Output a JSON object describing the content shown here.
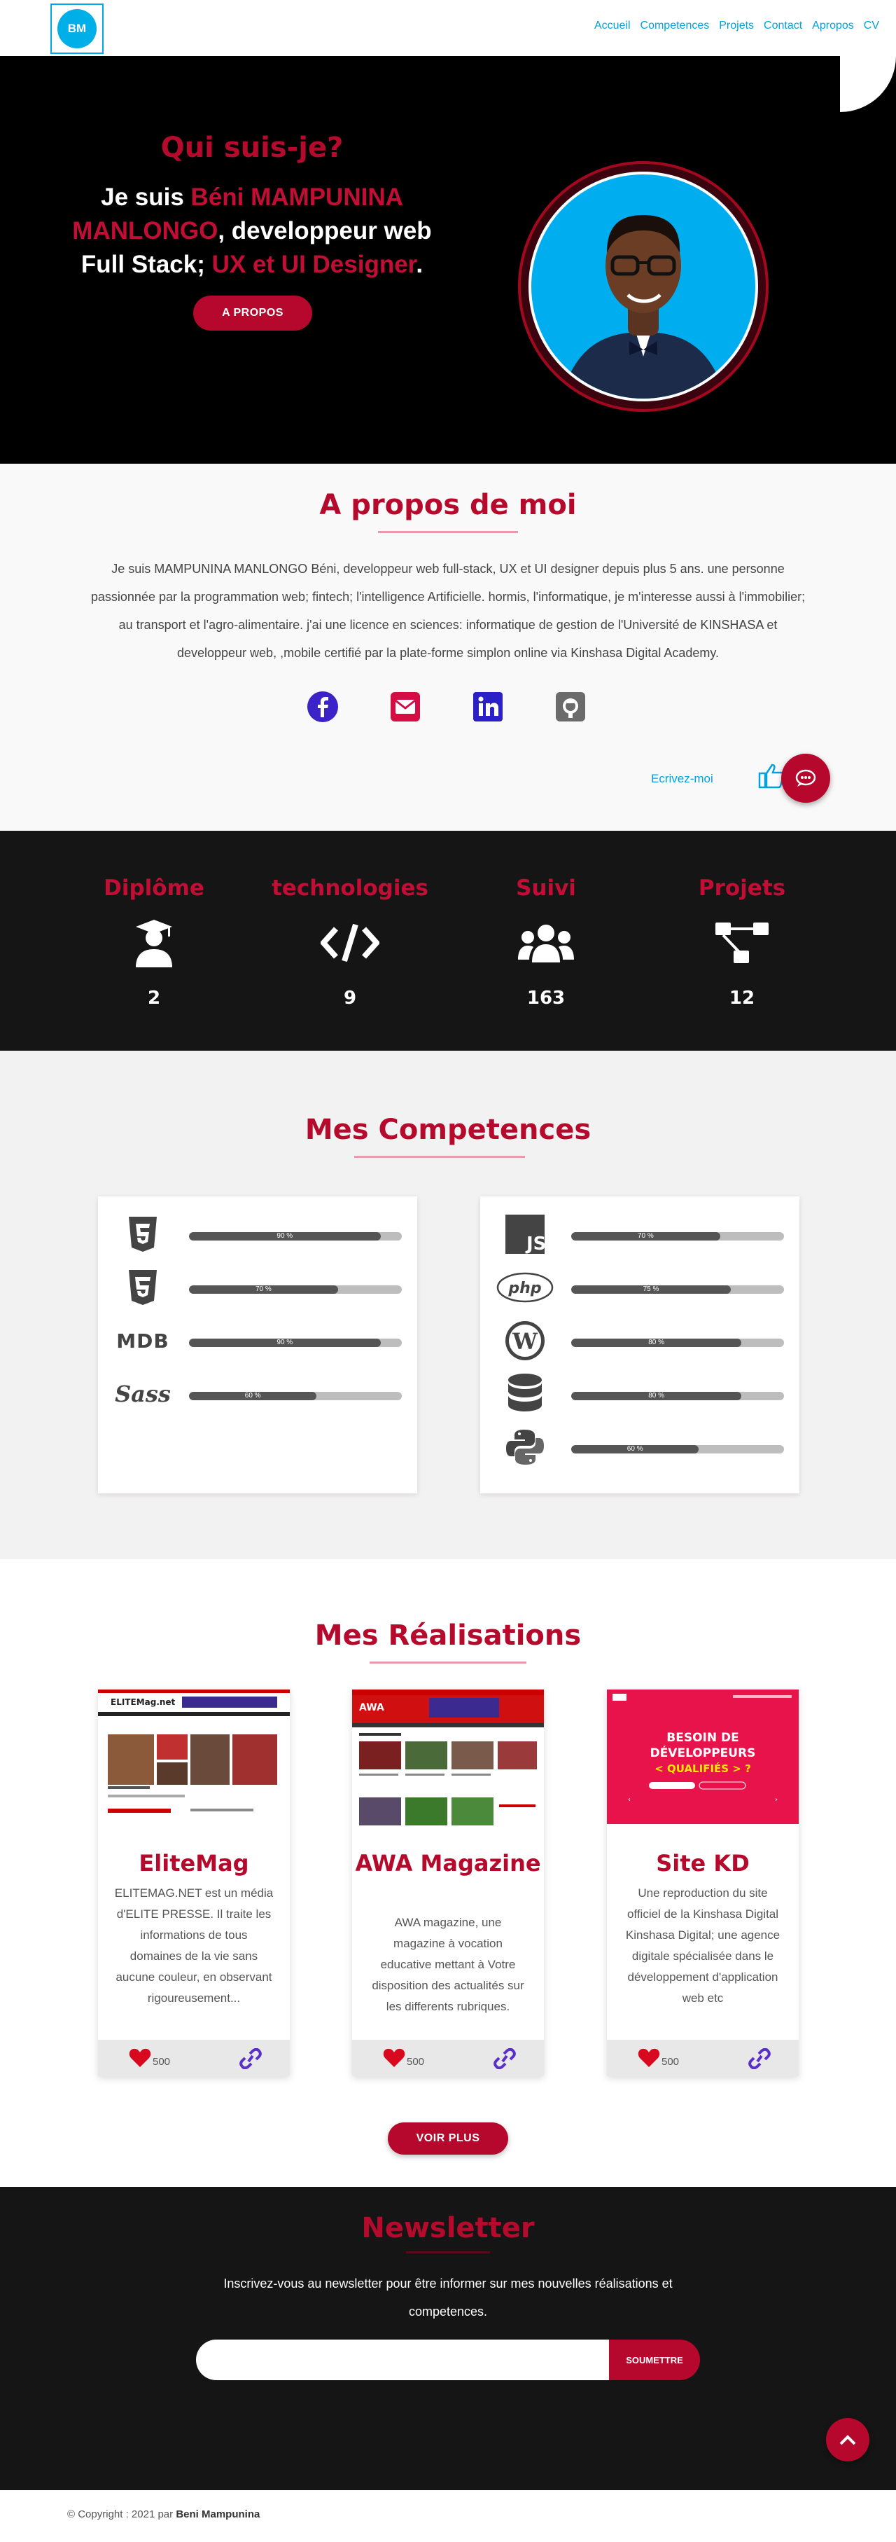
{
  "nav": {
    "logo": "BM",
    "items": [
      "Accueil",
      "Competences",
      "Projets",
      "Contact",
      "Apropos",
      "CV"
    ]
  },
  "hero": {
    "title": "Qui suis-je?",
    "intro_1": "Je suis ",
    "name": "Béni MAMPUNINA MANLONGO",
    "intro_2": ", developpeur web Full Stack; ",
    "role": "UX et UI Designer",
    "intro_3": ".",
    "button": "A PROPOS"
  },
  "about": {
    "title": "A propos de moi",
    "text": "Je suis MAMPUNINA MANLONGO Béni, developpeur web full-stack, UX et UI designer depuis plus 5 ans. une personne passionnée par la programmation web; fintech; l'intelligence Artificielle. hormis, l'informatique, je m'interesse aussi à l'immobilier; au transport et l'agro-alimentaire. j'ai une licence en sciences: informatique de gestion de l'Université de KINSHASA et developpeur web, ,mobile certifié par la plate-forme simplon online via Kinshasa Digital Academy.",
    "socials": [
      "facebook-icon",
      "email-icon",
      "linkedin-icon",
      "github-icon"
    ],
    "write": "Ecrivez-moi"
  },
  "stats": [
    {
      "label": "Diplôme",
      "icon": "graduate-icon",
      "value": "2"
    },
    {
      "label": "technologies",
      "icon": "code-icon",
      "value": "9"
    },
    {
      "label": "Suivi",
      "icon": "users-icon",
      "value": "163"
    },
    {
      "label": "Projets",
      "icon": "project-diagram-icon",
      "value": "12"
    }
  ],
  "skills": {
    "title": "Mes Competences",
    "left": [
      {
        "icon": "html5-icon",
        "label": "90 %",
        "level": 0.9
      },
      {
        "icon": "css3-icon",
        "label": "70 %",
        "level": 0.7
      },
      {
        "icon": "mdb-icon",
        "label": "90 %",
        "level": 0.9
      },
      {
        "icon": "sass-icon",
        "label": "60 %",
        "level": 0.6
      }
    ],
    "right": [
      {
        "icon": "js-icon",
        "label": "70 %",
        "level": 0.7
      },
      {
        "icon": "php-icon",
        "label": "75 %",
        "level": 0.75
      },
      {
        "icon": "wordpress-icon",
        "label": "80 %",
        "level": 0.8
      },
      {
        "icon": "database-icon",
        "label": "80 %",
        "level": 0.8
      },
      {
        "icon": "python-icon",
        "label": "60 %",
        "level": 0.6
      }
    ]
  },
  "projects": {
    "title": "Mes Réalisations",
    "items": [
      {
        "title": "EliteMag",
        "desc": "ELITEMAG.NET est un média d'ELITE PRESSE. Il traite les informations de tous domaines de la vie sans aucune couleur, en observant rigoureusement...",
        "likes": "500"
      },
      {
        "title": "AWA Magazine",
        "desc": "AWA magazine, une magazine à vocation educative mettant à Votre disposition des actualités sur les differents rubriques.",
        "likes": "500"
      },
      {
        "title": "Site KD",
        "desc": "Une reproduction du site officiel de la Kinshasa Digital Kinshasa Digital; une agence digitale spécialisée dans le développement d'application web etc",
        "likes": "500"
      }
    ],
    "more": "VOIR PLUS",
    "kd_banner_1": "BESOIN DE",
    "kd_banner_2": "DÉVELOPPEURS",
    "kd_banner_3": "< QUALIFIÉS > ?",
    "elite_logo": "ELITEMag.net",
    "awa_logo": "AWA"
  },
  "newsletter": {
    "title": "Newsletter",
    "text": "Inscrivez-vous au newsletter pour être informer sur mes nouvelles réalisations et competences.",
    "placeholder": "",
    "button": "SOUMETTRE"
  },
  "footer": {
    "prefix": "© Copyright : 2021 par ",
    "author": "Beni Mampunina"
  },
  "colors": {
    "accent": "#b5082c",
    "link": "#00a3e0",
    "dark": "#151515"
  }
}
